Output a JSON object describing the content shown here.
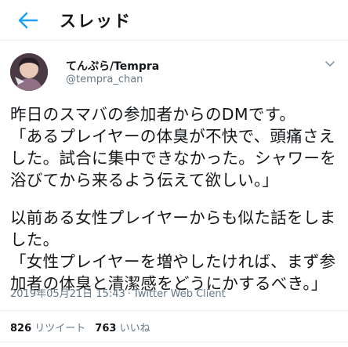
{
  "header": {
    "title": "スレッド",
    "back_icon": "arrow-left-icon"
  },
  "tweet": {
    "author": {
      "display_name": "てんぷら/Tempra",
      "handle": "@tempra_chan",
      "avatar_icon": "avatar-image"
    },
    "menu_icon": "chevron-down-icon",
    "body": {
      "paragraph_1": "昨日のスマバの参加者からのDMです。\n「あるプレイヤーの体臭が不快で、頭痛さえした。試合に集中できなかった。シャワーを浴びてから来るよう伝えて欲しい。」",
      "paragraph_2": "以前ある女性プレイヤーからも似た話をしました。\n「女性プレイヤーを増やしたければ、まず参加者の体臭と清潔感をどうにかするべき。」"
    },
    "timestamp": "2019年05月21日 15:43",
    "separator": "·",
    "source": "Twitter Web Client",
    "stats": {
      "retweets_count": "826",
      "retweets_label": "リツイート",
      "likes_count": "763",
      "likes_label": "いいね"
    }
  },
  "colors": {
    "accent": "#1da1f2",
    "text_primary": "#14171a",
    "text_secondary": "#657786",
    "border": "#e6ecf0"
  }
}
